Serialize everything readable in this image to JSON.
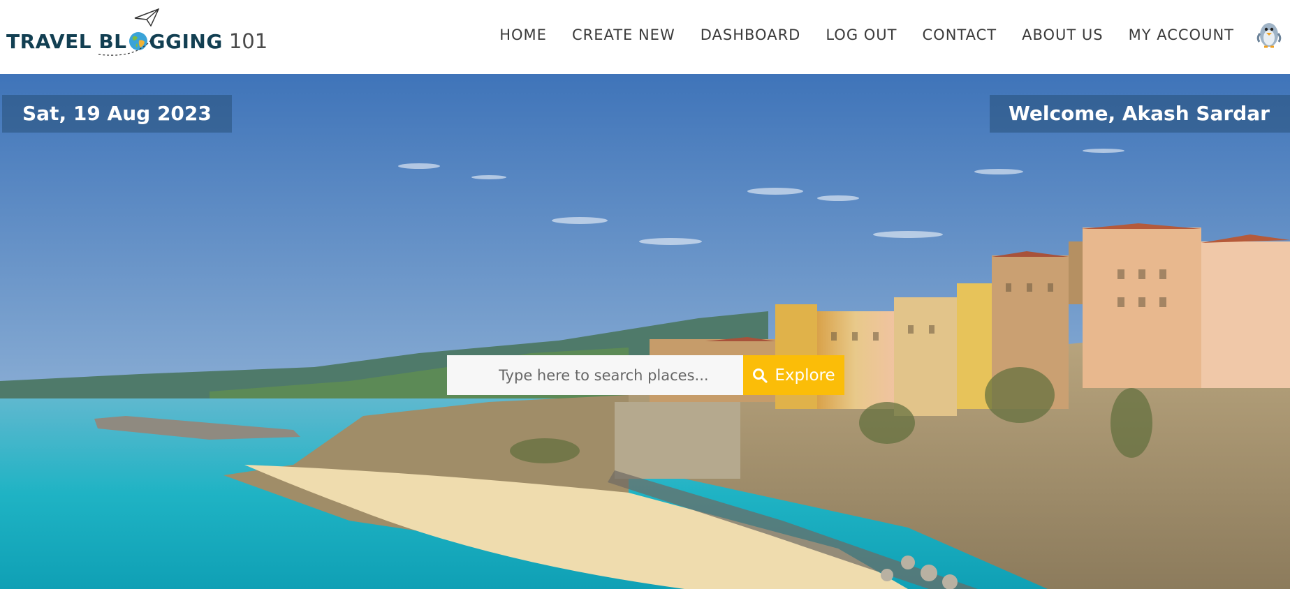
{
  "brand": {
    "part1": "TRAVEL BL",
    "part2": "GGING",
    "number": "101"
  },
  "nav": {
    "items": [
      {
        "label": "HOME"
      },
      {
        "label": "CREATE NEW"
      },
      {
        "label": "DASHBOARD"
      },
      {
        "label": "LOG OUT"
      },
      {
        "label": "CONTACT"
      },
      {
        "label": "ABOUT US"
      },
      {
        "label": "MY ACCOUNT"
      }
    ]
  },
  "hero": {
    "date": "Sat, 19 Aug 2023",
    "welcome": "Welcome, Akash Sardar"
  },
  "search": {
    "placeholder": "Type here to search places...",
    "button_label": "Explore",
    "button_icon": "search-icon"
  },
  "colors": {
    "brand": "#123f52",
    "accent": "#fbbd08",
    "badge_bg": "rgba(40,80,120,0.55)"
  }
}
